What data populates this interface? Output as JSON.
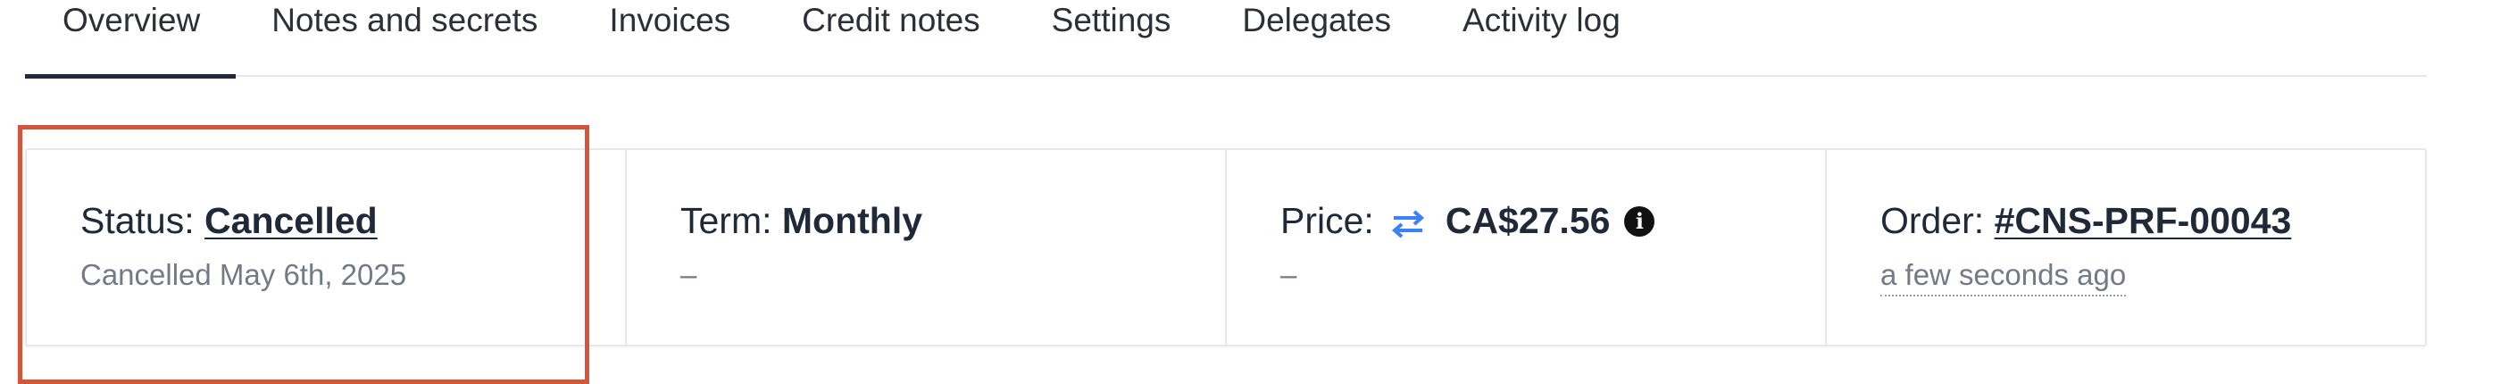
{
  "tabs": [
    {
      "label": "Overview"
    },
    {
      "label": "Notes and secrets"
    },
    {
      "label": "Invoices"
    },
    {
      "label": "Credit notes"
    },
    {
      "label": "Settings"
    },
    {
      "label": "Delegates"
    },
    {
      "label": "Activity log"
    }
  ],
  "overview": {
    "status": {
      "label": "Status:",
      "value": "Cancelled",
      "sub": "Cancelled May 6th, 2025"
    },
    "term": {
      "label": "Term:",
      "value": "Monthly",
      "sub": "–"
    },
    "price": {
      "label": "Price:",
      "value": "CA$27.56",
      "sub": "–",
      "icon": "swap-arrows-icon",
      "info_icon": "info-icon",
      "icon_color": "#3b82f6"
    },
    "order": {
      "label": "Order:",
      "value": "#CNS-PRF-00043",
      "sub": "a few seconds ago"
    }
  },
  "colors": {
    "highlight": "#d4553b"
  }
}
